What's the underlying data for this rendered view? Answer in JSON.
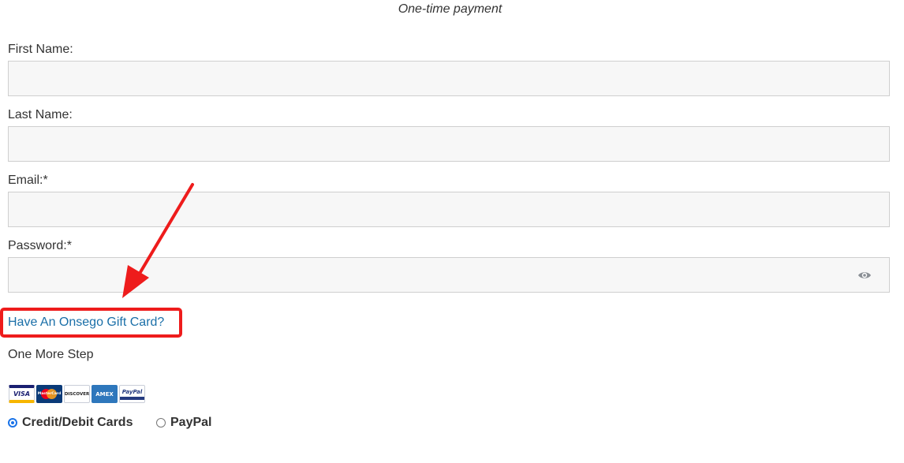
{
  "form": {
    "subtitle": "One-time payment",
    "first_name": {
      "label": "First Name:",
      "value": "",
      "placeholder": ""
    },
    "last_name": {
      "label": "Last Name:",
      "value": "",
      "placeholder": ""
    },
    "email": {
      "label": "Email:*",
      "value": "",
      "placeholder": ""
    },
    "password": {
      "label": "Password:*",
      "value": "",
      "placeholder": "",
      "toggle_icon": "eye-icon"
    }
  },
  "gift_card_link": "Have An Onsego Gift Card?",
  "annotation": {
    "highlight_color": "#ee1c1c"
  },
  "step_text": "One More Step",
  "payment_cards": {
    "visa": "VISA",
    "mastercard": "MasterCard",
    "discover": "DISCOVER",
    "amex": "AMEX",
    "paypal": "PayPal"
  },
  "payment_options": [
    {
      "label": "Credit/Debit Cards",
      "selected": true
    },
    {
      "label": "PayPal",
      "selected": false
    }
  ],
  "colors": {
    "link": "#1a6fa8",
    "radio_selected": "#1a73e8",
    "input_bg": "#f7f7f7"
  }
}
